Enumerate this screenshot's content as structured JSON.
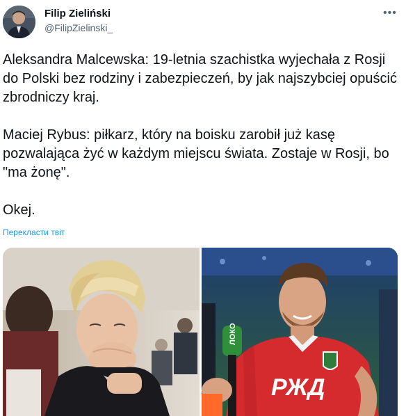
{
  "author": {
    "name": "Filip Zieliński",
    "handle": "@FilipZielinski_"
  },
  "menu_icon": "more-horizontal-icon",
  "tweet": {
    "paragraphs": [
      "Aleksandra Malcewska: 19-letnia szachistka wyjechała z Rosji do Polski bez rodziny i zabezpieczeń, by jak najszybciej opuścić zbrodniczy kraj.",
      "Maciej Rybus: piłkarz, który na boisku zarobił już kasę pozwalająca żyć w każdym miejscu świata. Zostaje w Rosji, bo \"ma żonę\".",
      "Okej."
    ],
    "translate_label": "Перекласти твіт"
  },
  "media": {
    "right_photo": {
      "mic_text": "ЛОКО",
      "jersey_sponsor": "РЖД"
    }
  },
  "colors": {
    "link": "#1d9bf0",
    "text": "#0f1419",
    "secondary": "#536471",
    "jersey_red": "#d52b2f"
  }
}
